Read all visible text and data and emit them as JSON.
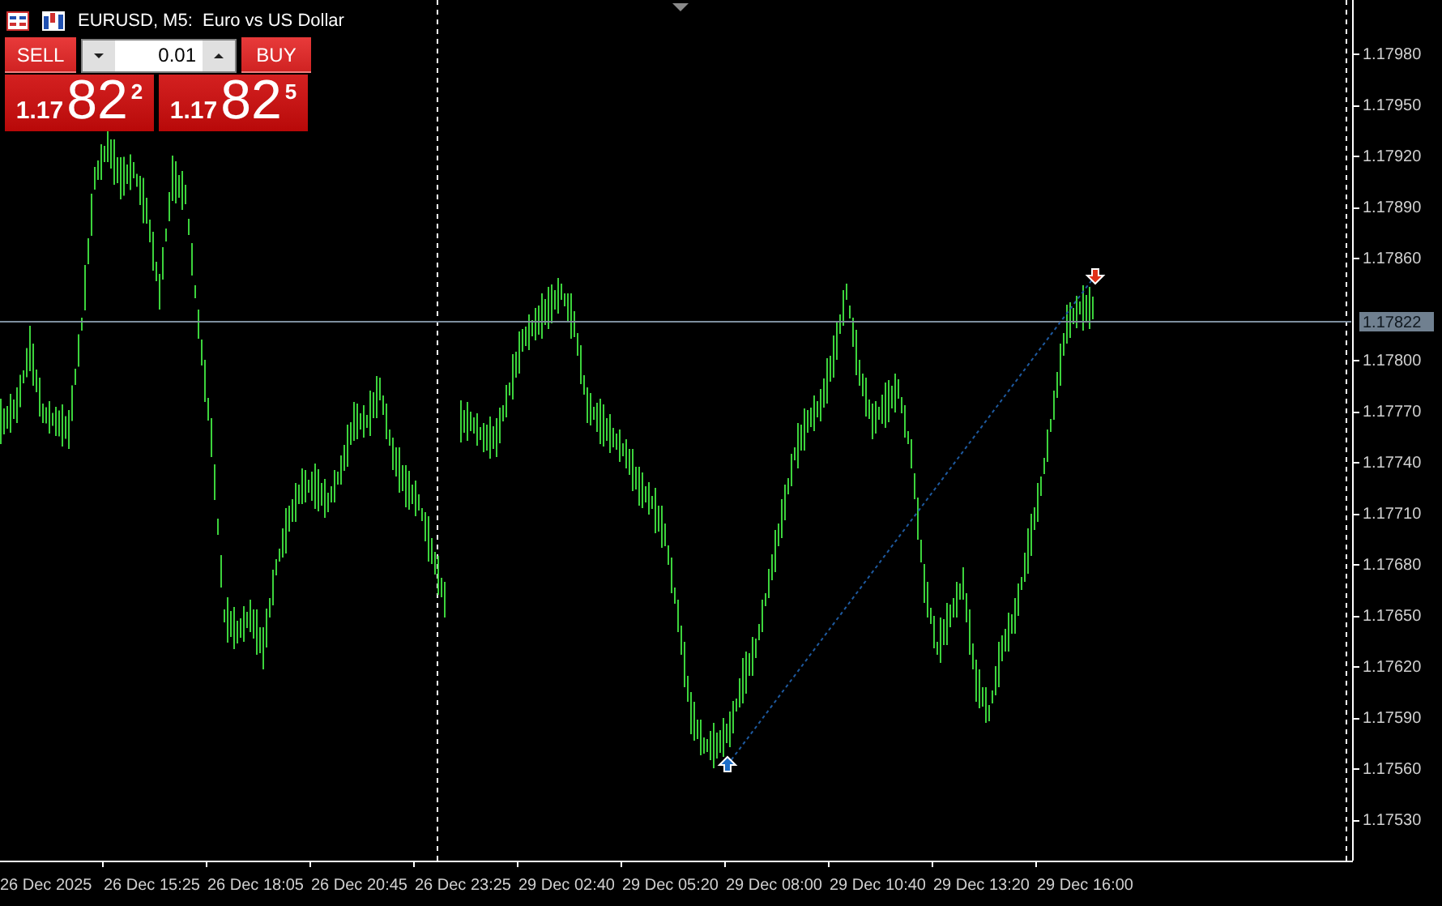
{
  "window": {
    "title": "EURUSD, M5:  Euro vs US Dollar"
  },
  "trade_panel": {
    "sell": {
      "label": "SELL",
      "price_prefix": "1.17",
      "price_big": "82",
      "price_last": "2"
    },
    "volume": {
      "value": "0.01"
    },
    "buy": {
      "label": "BUY",
      "price_prefix": "1.17",
      "price_big": "82",
      "price_last": "5"
    }
  },
  "chart": {
    "current_price": "1.17822",
    "price_labels": [
      "1.17980",
      "1.17950",
      "1.17920",
      "1.17890",
      "1.17860",
      "1.17800",
      "1.17770",
      "1.17740",
      "1.17710",
      "1.17680",
      "1.17650",
      "1.17620",
      "1.17590",
      "1.17560",
      "1.17530"
    ],
    "time_labels": [
      "26 Dec 2025",
      "26 Dec 15:25",
      "26 Dec 18:05",
      "26 Dec 20:45",
      "26 Dec 23:25",
      "29 Dec 02:40",
      "29 Dec 05:20",
      "29 Dec 08:00",
      "29 Dec 10:40",
      "29 Dec 13:20",
      "29 Dec 16:00"
    ]
  }
}
